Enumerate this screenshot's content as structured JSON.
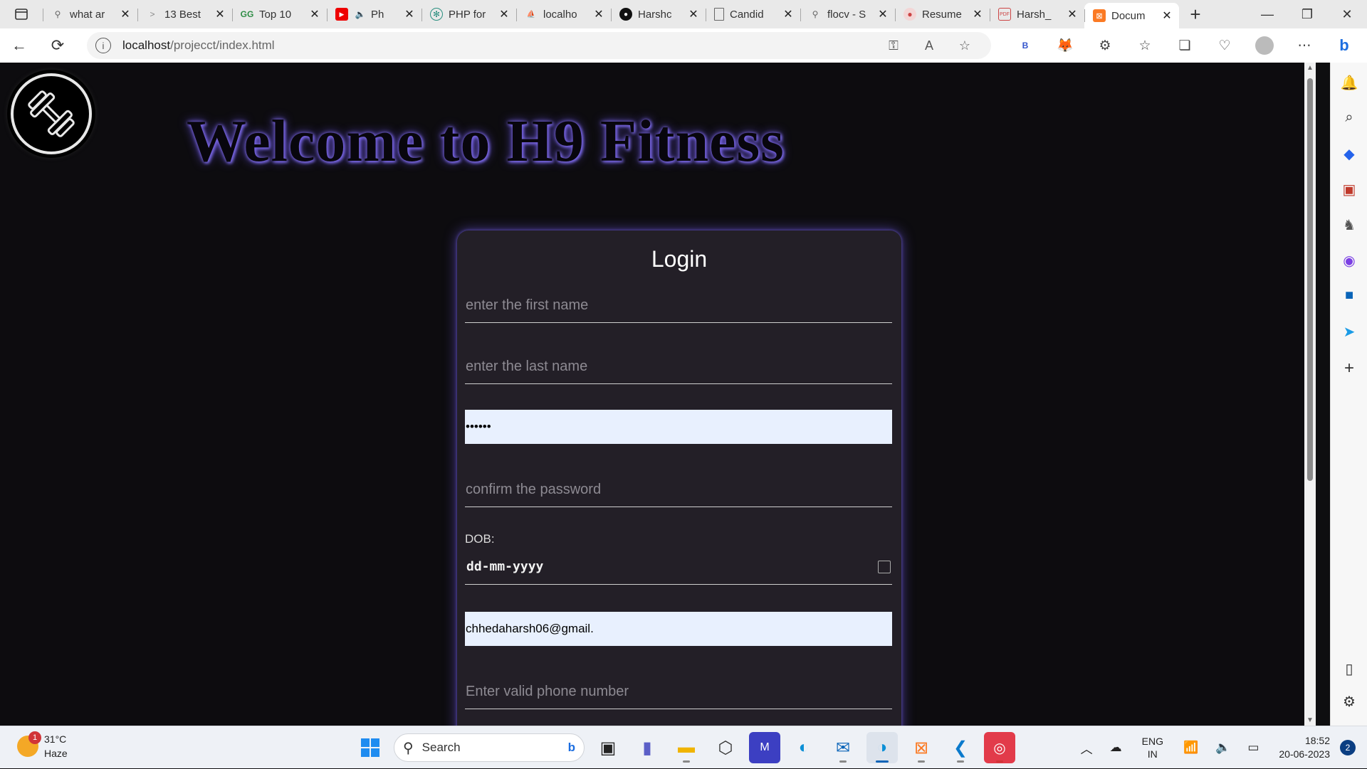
{
  "browser": {
    "tabs": [
      {
        "title": "what ar",
        "icon": "search-icon"
      },
      {
        "title": "13 Best",
        "icon": "code-icon"
      },
      {
        "title": "Top 10",
        "icon": "gfg-icon"
      },
      {
        "title": "Ph",
        "icon": "youtube-icon"
      },
      {
        "title": "PHP for",
        "icon": "chatgpt-icon"
      },
      {
        "title": "localho",
        "icon": "phpmyadmin-icon"
      },
      {
        "title": "Harshc",
        "icon": "github-icon"
      },
      {
        "title": "Candid",
        "icon": "document-icon"
      },
      {
        "title": "flocv - S",
        "icon": "search-icon"
      },
      {
        "title": "Resume",
        "icon": "resume-icon"
      },
      {
        "title": "Harsh_",
        "icon": "pdf-icon"
      },
      {
        "title": "Docum",
        "icon": "xampp-icon",
        "active": true
      }
    ],
    "url_host": "localhost",
    "url_path": "/projecct/index.html"
  },
  "page": {
    "heading": "Welcome to H9 Fitness",
    "form": {
      "title": "Login",
      "first_name_placeholder": "enter the first name",
      "last_name_placeholder": "enter the last name",
      "password_value": "••••••",
      "confirm_password_placeholder": "confirm the password",
      "dob_label": "DOB:",
      "dob_value": "dd-mm-yyyy",
      "email_value": "chhedaharsh06@gmail.",
      "phone_placeholder": "Enter valid phone number"
    }
  },
  "taskbar": {
    "weather_temp": "31°C",
    "weather_desc": "Haze",
    "weather_badge": "1",
    "search_label": "Search",
    "lang_1": "ENG",
    "lang_2": "IN",
    "time": "18:52",
    "date": "20-06-2023",
    "notification_count": "2"
  }
}
